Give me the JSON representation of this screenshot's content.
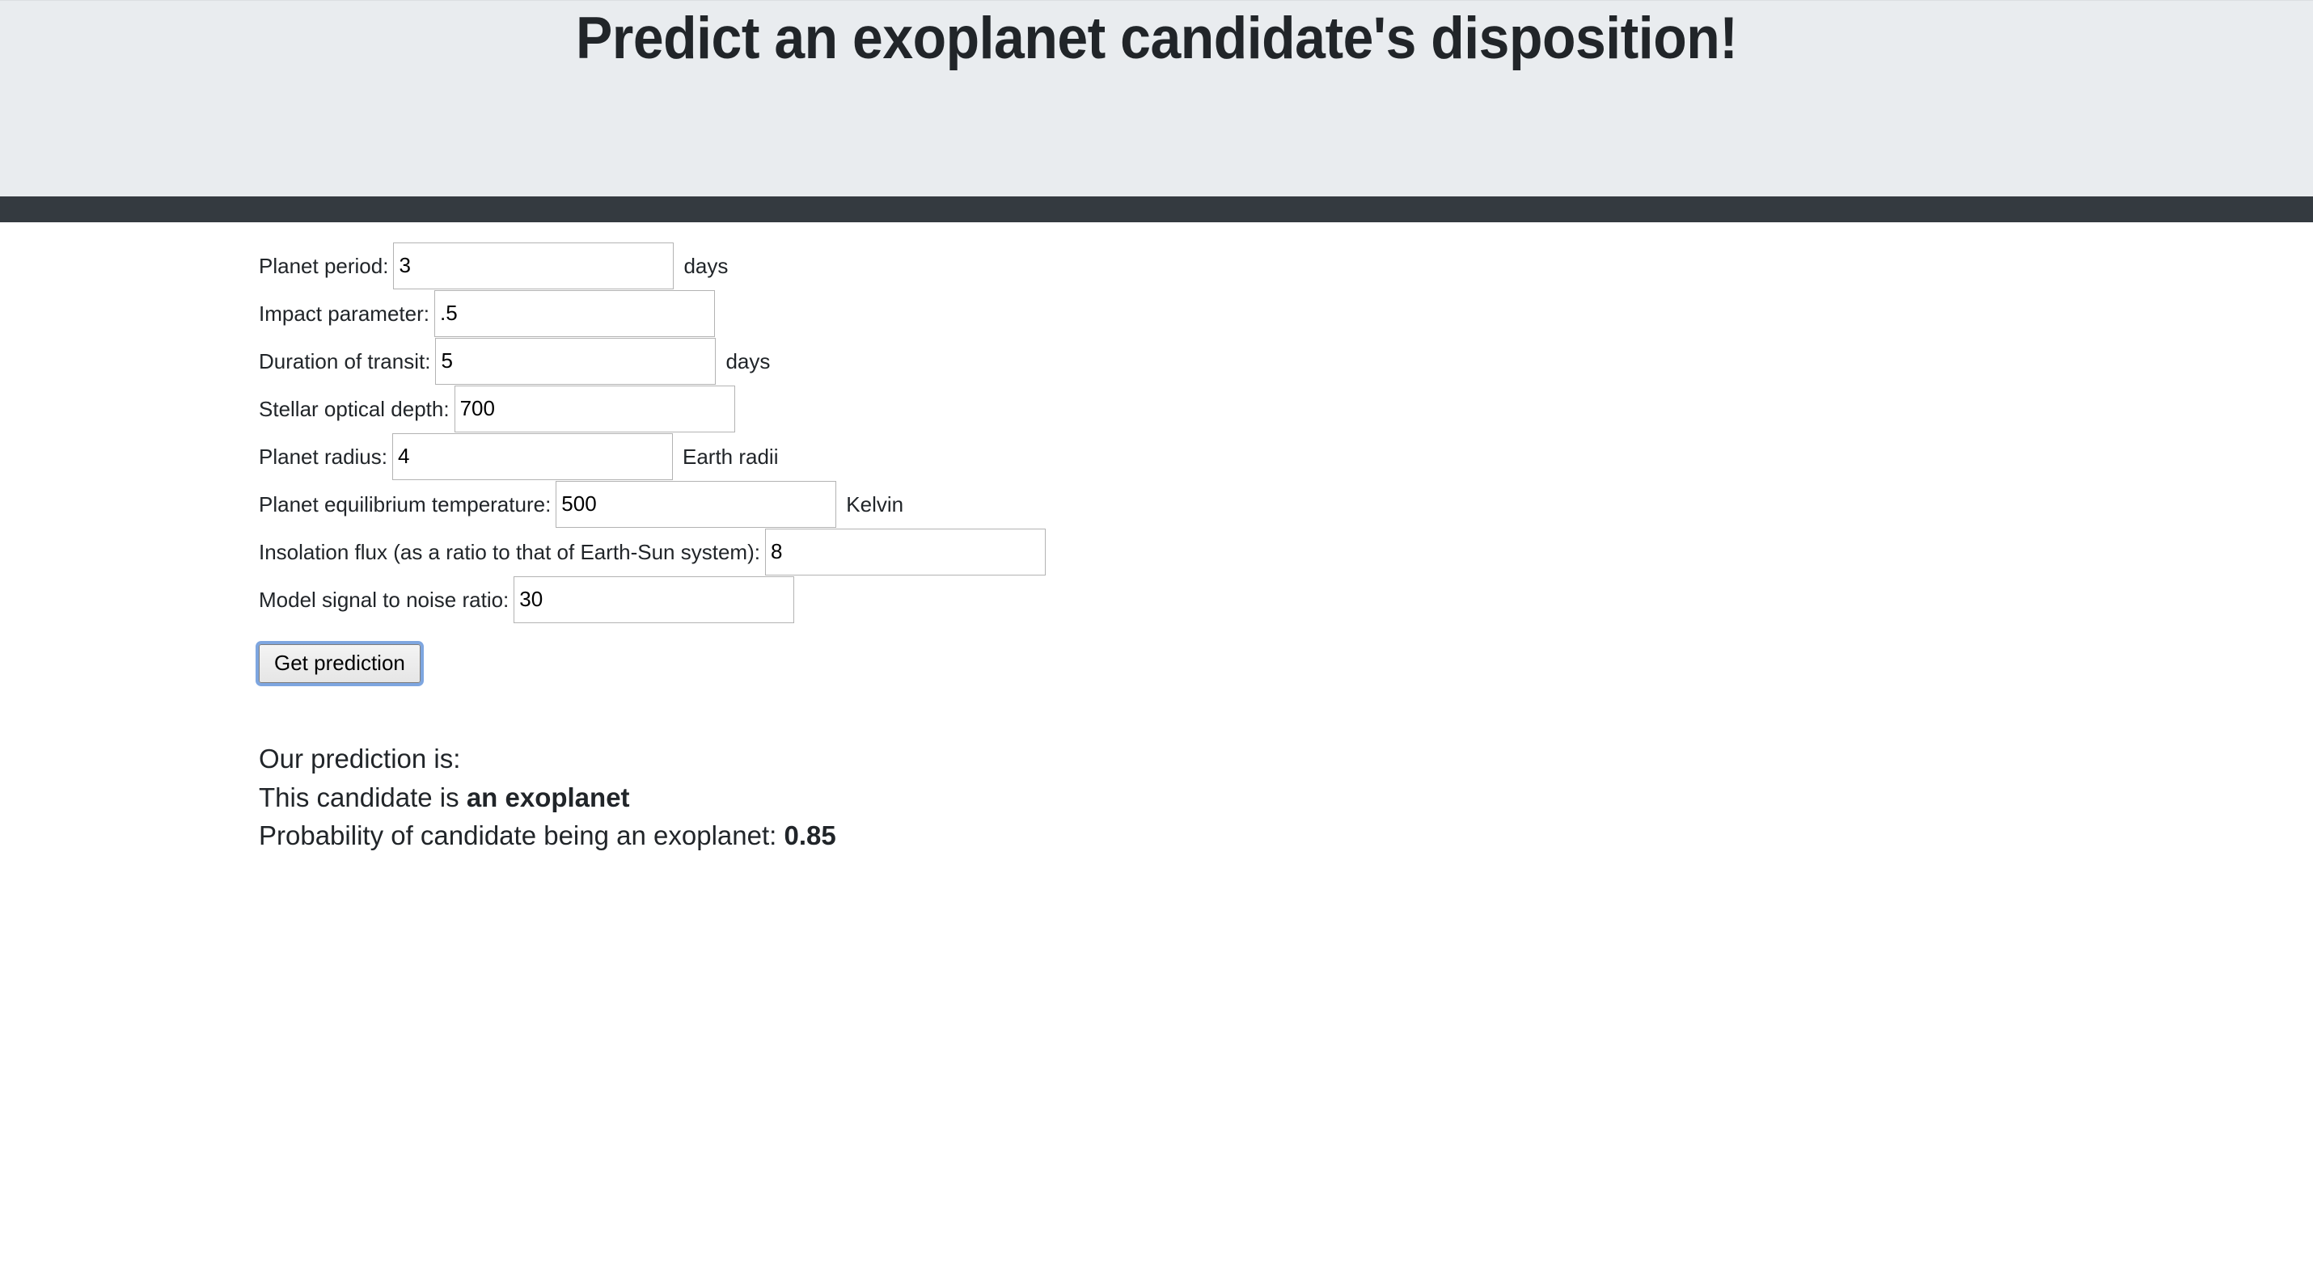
{
  "header": {
    "title": "Predict an exoplanet candidate's disposition!",
    "background_color": "#e9ecef",
    "strip_color": "#343a40"
  },
  "form": {
    "fields": [
      {
        "label": "Planet period:",
        "value": "3",
        "unit": "days"
      },
      {
        "label": "Impact parameter:",
        "value": ".5",
        "unit": ""
      },
      {
        "label": "Duration of transit:",
        "value": "5",
        "unit": "days"
      },
      {
        "label": "Stellar optical depth:",
        "value": "700",
        "unit": ""
      },
      {
        "label": "Planet radius:",
        "value": "4",
        "unit": "Earth radii"
      },
      {
        "label": "Planet equilibrium temperature:",
        "value": "500",
        "unit": "Kelvin"
      },
      {
        "label": "Insolation flux (as a ratio to that of Earth-Sun system):",
        "value": "8",
        "unit": ""
      },
      {
        "label": "Model signal to noise ratio:",
        "value": "30",
        "unit": ""
      }
    ],
    "submit_label": "Get prediction"
  },
  "results": {
    "heading": "Our prediction is:",
    "verdict_prefix": "This candidate is ",
    "verdict": "an exoplanet",
    "probability_prefix": "Probability of candidate being an exoplanet: ",
    "probability": "0.85"
  }
}
